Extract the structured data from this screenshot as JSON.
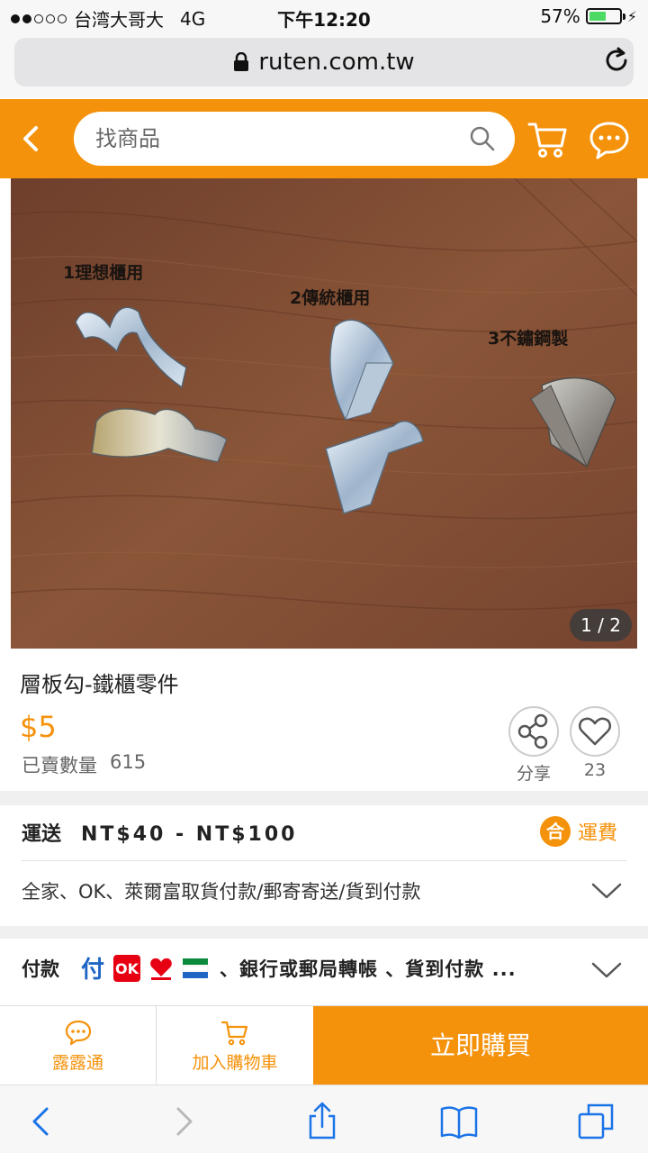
{
  "status_bar": {
    "carrier": "台湾大哥大",
    "network": "4G",
    "time": "下午12:20",
    "battery": "57%",
    "battery_level": 0.57
  },
  "browser": {
    "url": "ruten.com.tw"
  },
  "header": {
    "search_placeholder": "找商品"
  },
  "gallery": {
    "counter": "1 / 2",
    "image_labels": [
      "1理想櫃用",
      "2傳統櫃用",
      "3不鏽鋼製"
    ]
  },
  "product": {
    "title": "層板勾-鐵櫃零件",
    "price": "$5",
    "sold_label": "已賣數量",
    "sold_count": "615",
    "share_label": "分享",
    "like_count": "23"
  },
  "shipping": {
    "label": "運送",
    "range": "NT$40 - NT$100",
    "fee_badge": "合",
    "fee_label": "運費",
    "methods": "全家、OK、萊爾富取貨付款/郵寄寄送/貨到付款"
  },
  "payment": {
    "label": "付款",
    "icons": [
      "fu-pay-icon",
      "ok-mart-icon",
      "hilife-icon",
      "familymart-icon"
    ],
    "rest": "、銀行或郵局轉帳  、貨到付款 ..."
  },
  "actions": {
    "chat_label": "露露通",
    "cart_label": "加入購物車",
    "buy_label": "立即購買"
  },
  "colors": {
    "brand": "#f5920b"
  }
}
